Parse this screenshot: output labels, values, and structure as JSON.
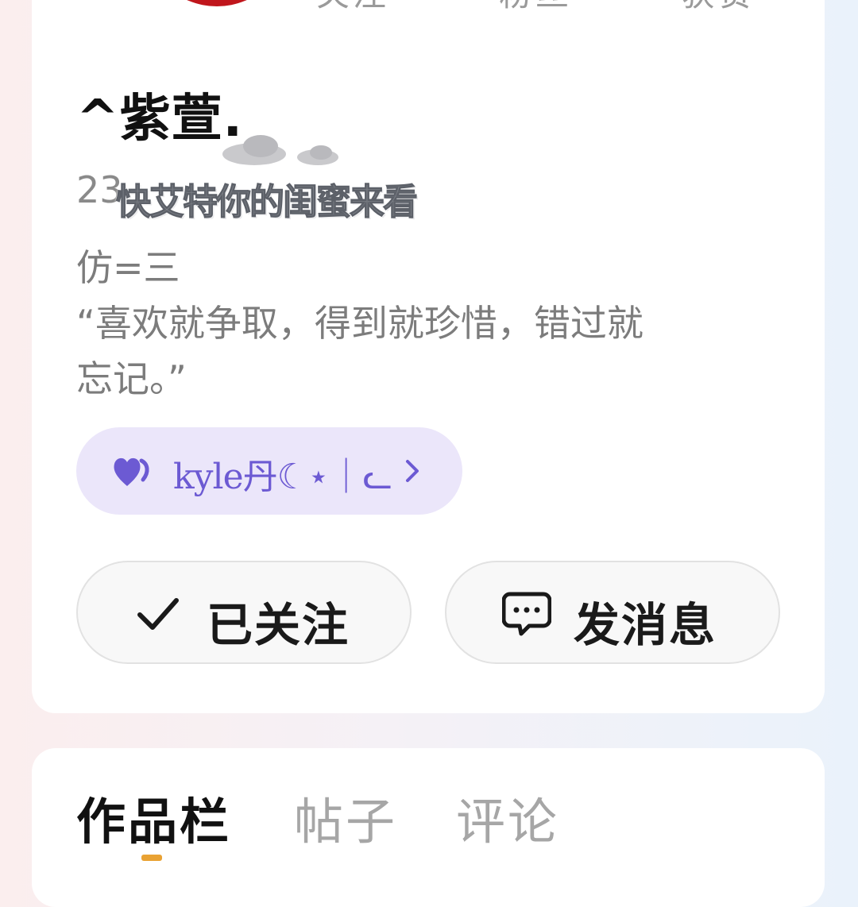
{
  "profile": {
    "stats": [
      {
        "label": "关注"
      },
      {
        "label": "粉丝"
      },
      {
        "label": "获赞"
      }
    ],
    "name": "^紫萱.",
    "id_prefix": "23",
    "caption": "快艾特你的闺蜜来看",
    "bio_line1": "仿=三",
    "bio_line2": "“喜欢就争取，得到就珍惜，错过就",
    "bio_line3": "忘记。”",
    "tag_text": "kyle丹☾⋆｜ᓚ",
    "tag_color": "#6c5ad3",
    "tag_bg": "#ebe6fa"
  },
  "actions": {
    "follow_label": "已关注",
    "message_label": "发消息"
  },
  "tabs": [
    {
      "label": "作品栏",
      "active": true
    },
    {
      "label": "帖子",
      "active": false
    },
    {
      "label": "评论",
      "active": false
    }
  ]
}
